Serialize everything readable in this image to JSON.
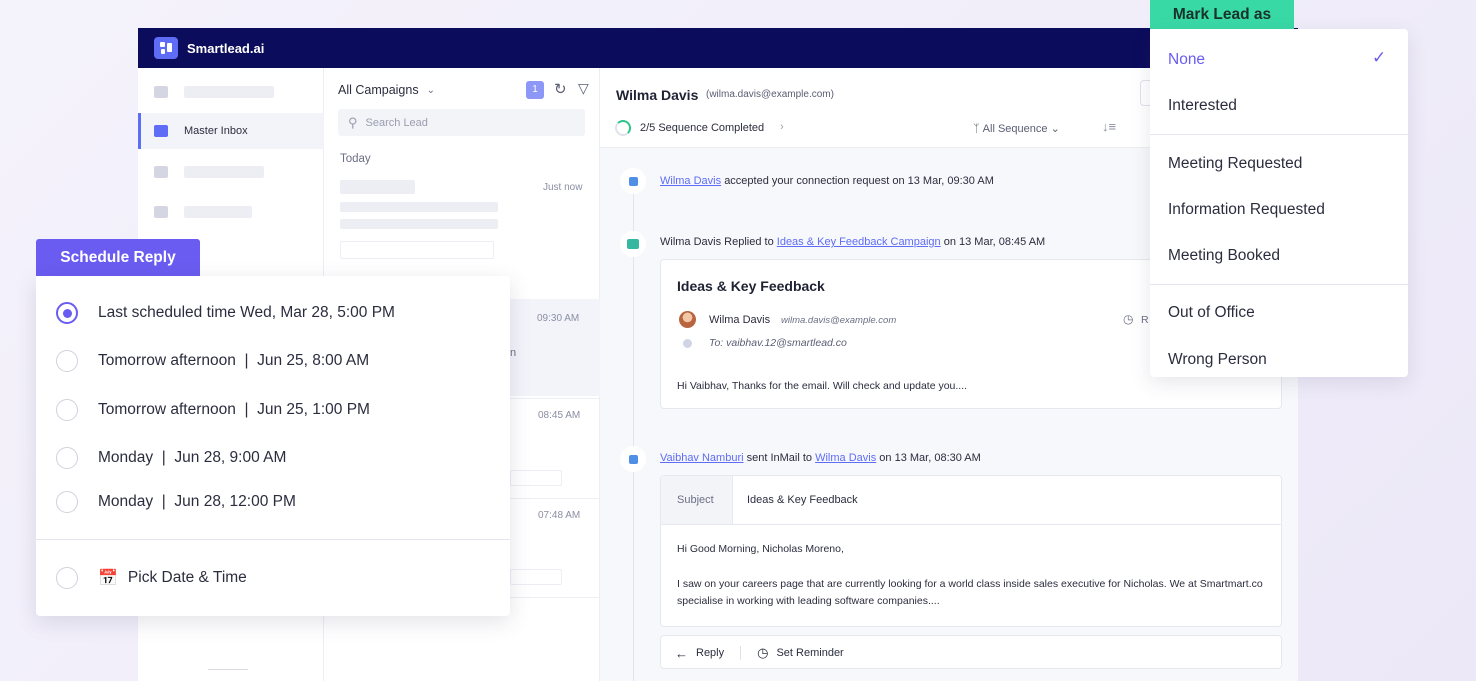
{
  "app": {
    "brand": "Smartlead.ai"
  },
  "nav": {
    "active_label": "Master Inbox"
  },
  "list": {
    "campaign_select": "All Campaigns",
    "unread_badge": "1",
    "search_placeholder": "Search Lead",
    "group_label": "Today",
    "times": [
      "Just now",
      "09:30 AM",
      "08:45 AM",
      "07:48 AM"
    ],
    "partial_text": "n"
  },
  "conversation": {
    "lead_name": "Wilma Davis",
    "lead_email": "(wilma.davis@example.com)",
    "sequence_status": "2/5 Sequence Completed",
    "sequence_filter": "All Sequence",
    "events": [
      {
        "actor": "Wilma Davis",
        "text": "accepted your connection request on 13 Mar, 09:30 AM"
      },
      {
        "actor": "Wilma Davis Replied to",
        "campaign": "Ideas & Key Feedback Campaign",
        "text": "on 13 Mar, 08:45 AM"
      },
      {
        "sender": "Vaibhav Namburi",
        "middle": "sent InMail to",
        "recipient": "Wilma Davis",
        "text": "on 13 Mar, 08:30 AM"
      }
    ],
    "reply_card": {
      "title": "Ideas & Key Feedback",
      "from_name": "Wilma Davis",
      "from_email": "wilma.davis@example.com",
      "to": "To: vaibhav.12@smartlead.co",
      "time_partial": "R",
      "body": "Hi Vaibhav, Thanks for the email. Will check and update you...."
    },
    "inmail_card": {
      "subject_label": "Subject",
      "subject": "Ideas & Key Feedback",
      "greeting": "Hi Good Morning, Nicholas Moreno,",
      "body": "I saw on your careers page that are currently looking for a world class inside sales executive for Nicholas. We at Smartmart.co specialise in working with leading software companies...."
    },
    "actions": {
      "reply": "Reply",
      "reminder": "Set Reminder"
    }
  },
  "schedule": {
    "title": "Schedule Reply",
    "options": [
      "Last scheduled time Wed, Mar 28, 5:00 PM",
      "Tomorrow afternoon  |  Jun 25, 8:00 AM",
      "Tomorrow afternoon  |  Jun 25, 1:00 PM",
      "Monday  |  Jun 28, 9:00 AM",
      "Monday  |  Jun 28, 12:00 PM"
    ],
    "selected_index": 0,
    "pick": "Pick Date & Time"
  },
  "mark_lead": {
    "title": "Mark Lead as",
    "items": [
      "None",
      "Interested",
      "Meeting Requested",
      "Information Requested",
      "Meeting Booked",
      "Out of Office",
      "Wrong Person"
    ],
    "selected": "None"
  },
  "colors": {
    "navy": "#0c0c5c",
    "accent": "#6a5cf0",
    "green": "#39d9a5",
    "link": "#5e6cf6"
  }
}
